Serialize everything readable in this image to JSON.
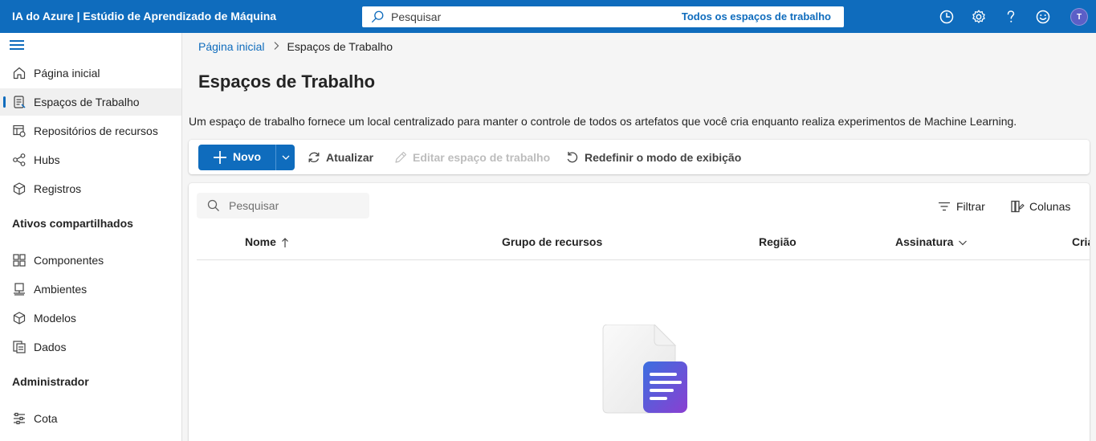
{
  "topbar": {
    "title": "IA do Azure | Estúdio de Aprendizado de Máquina",
    "search_placeholder": "Pesquisar",
    "search_scope": "Todos os espaços de trabalho",
    "icons": [
      "clock-icon",
      "gear-icon",
      "help-icon",
      "smiley-icon"
    ],
    "avatar_initial": "T"
  },
  "sidebar": {
    "items": [
      {
        "label": "Página inicial",
        "icon": "home-icon"
      },
      {
        "label": "Espaços de Trabalho",
        "icon": "workspace-icon",
        "active": true
      },
      {
        "label": "Repositórios de recursos",
        "icon": "feature-store-icon"
      },
      {
        "label": "Hubs",
        "icon": "hub-icon"
      },
      {
        "label": "Registros",
        "icon": "registry-icon"
      }
    ],
    "shared_section": "Ativos compartilhados",
    "shared_items": [
      {
        "label": "Componentes",
        "icon": "components-icon"
      },
      {
        "label": "Ambientes",
        "icon": "environments-icon"
      },
      {
        "label": "Modelos",
        "icon": "models-icon"
      },
      {
        "label": "Dados",
        "icon": "data-icon"
      }
    ],
    "admin_section": "Administrador",
    "admin_items": [
      {
        "label": "Cota",
        "icon": "quota-icon"
      }
    ]
  },
  "breadcrumb": {
    "home": "Página inicial",
    "current": "Espaços de Trabalho"
  },
  "page": {
    "title": "Espaços de Trabalho",
    "description": "Um espaço de trabalho fornece um local centralizado para manter o controle de todos os artefatos que você cria enquanto realiza experimentos de Machine Learning."
  },
  "toolbar": {
    "new_label": "Novo",
    "refresh_label": "Atualizar",
    "edit_label": "Editar espaço de trabalho",
    "reset_view_label": "Redefinir o modo de exibição"
  },
  "grid": {
    "search_placeholder": "Pesquisar",
    "filter_label": "Filtrar",
    "columns_label": "Colunas",
    "headers": [
      "Nome",
      "Grupo de recursos",
      "Região",
      "Assinatura",
      "Cria"
    ]
  },
  "colors": {
    "brand": "#0f6cbd",
    "sidebar_active": "#f0f0f0"
  }
}
